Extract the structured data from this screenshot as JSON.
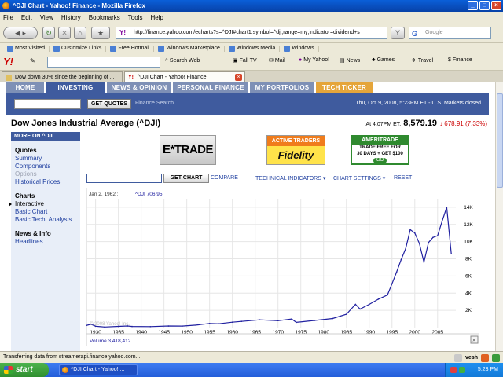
{
  "window": {
    "title": "^DJI Chart - Yahoo! Finance - Mozilla Firefox",
    "min": "_",
    "max": "□",
    "close": "×"
  },
  "menu": [
    "File",
    "Edit",
    "View",
    "History",
    "Bookmarks",
    "Tools",
    "Help"
  ],
  "nav": {
    "url": "http://finance.yahoo.com/echarts?s=^DJI#chart1:symbol=^dji;range=my;indicator=dividend+s",
    "search_placeholder": "Google",
    "back_icon": "back-arrow-icon",
    "reload_icon": "reload-icon"
  },
  "bookmarks": [
    "Most Visited",
    "Customize Links",
    "Free Hotmail",
    "Windows Marketplace",
    "Windows Media",
    "Windows"
  ],
  "ytoolbar": {
    "logo": "Y!",
    "search_web": "Search Web",
    "items": [
      "Fall TV",
      "Mail",
      "My Yahoo!",
      "News",
      "Games",
      "Travel",
      "Finance"
    ]
  },
  "tabs": [
    {
      "label": "Dow down 30% since the beginning of ...",
      "active": false
    },
    {
      "label": "^DJI Chart - Yahoo! Finance",
      "active": true
    }
  ],
  "site": {
    "nav_tabs": [
      "HOME",
      "INVESTING",
      "NEWS & OPINION",
      "PERSONAL FINANCE",
      "MY PORTFOLIOS",
      "TECH TICKER"
    ],
    "get_quotes": "GET QUOTES",
    "finance_search": "Finance Search",
    "market_status": "Thu, Oct 9, 2008, 5:23PM ET - U.S. Markets closed.",
    "title": "Dow Jones Industrial Average (^DJI)",
    "quote_time": "At 4:07PM ET:",
    "price": "8,579.19",
    "change": "↓ 678.91 (7.33%)"
  },
  "leftnav": {
    "header": "MORE ON ^DJI",
    "groups": [
      {
        "title": "Quotes",
        "links": [
          {
            "label": "Summary",
            "state": "link"
          },
          {
            "label": "Components",
            "state": "link"
          },
          {
            "label": "Options",
            "state": "dim"
          },
          {
            "label": "Historical Prices",
            "state": "link"
          }
        ]
      },
      {
        "title": "Charts",
        "links": [
          {
            "label": "Interactive",
            "state": "current"
          },
          {
            "label": "Basic Chart",
            "state": "link"
          },
          {
            "label": "Basic Tech. Analysis",
            "state": "link"
          }
        ]
      },
      {
        "title": "News & Info",
        "links": [
          {
            "label": "Headlines",
            "state": "link"
          }
        ]
      }
    ]
  },
  "ads": {
    "etrade": "E*TRADE",
    "fidelity_top": "ACTIVE TRADERS",
    "fidelity_brand": "Fidelity",
    "td_top": "AMERITRADE",
    "td_line1": "TRADE FREE FOR",
    "td_line2": "30 DAYS + GET $100",
    "td_go": "GO"
  },
  "chart_controls": {
    "get_chart": "GET CHART",
    "compare": "COMPARE",
    "indicators": "TECHNICAL INDICATORS ▾",
    "settings": "CHART SETTINGS ▾",
    "reset": "RESET"
  },
  "chart_data": {
    "type": "line",
    "legend_date": "Jan 2, 1962 :",
    "series_name": "^DJI 706.95",
    "copyright": "© 2008 Yahoo! Inc.",
    "volume_label": "Volume 3,418,412",
    "x_ticks": [
      "1930",
      "1935",
      "1940",
      "1945",
      "1950",
      "1955",
      "1960",
      "1965",
      "1970",
      "1975",
      "1980",
      "1985",
      "1990",
      "1995",
      "2000",
      "2005"
    ],
    "y_ticks": [
      "2K",
      "4K",
      "6K",
      "8K",
      "10K",
      "12K",
      "14K"
    ],
    "xlim": [
      1928,
      2009
    ],
    "ylim": [
      0,
      15000
    ],
    "colors": {
      "line": "#2020a0",
      "grid": "#e6e6e6"
    },
    "x": [
      1928,
      1929,
      1930,
      1932,
      1935,
      1937,
      1938,
      1942,
      1946,
      1949,
      1952,
      1955,
      1957,
      1960,
      1962,
      1966,
      1970,
      1973,
      1974,
      1978,
      1982,
      1985,
      1987,
      1988,
      1990,
      1992,
      1994,
      1995,
      1996,
      1997,
      1998,
      1999,
      2000,
      2001,
      2002,
      2003,
      2004,
      2005,
      2006,
      2007,
      2008
    ],
    "values": [
      250,
      380,
      160,
      60,
      140,
      185,
      130,
      110,
      180,
      175,
      280,
      480,
      440,
      620,
      710,
      900,
      800,
      1000,
      600,
      820,
      1050,
      1550,
      2700,
      2150,
      2700,
      3300,
      3800,
      5100,
      6450,
      7900,
      9200,
      11400,
      11000,
      9800,
      7600,
      9900,
      10500,
      10700,
      12400,
      14000,
      8579
    ]
  },
  "status": {
    "text": "Transferring data from streamerapi.finance.yahoo.com...",
    "right": "vesh"
  },
  "taskbar": {
    "start": "start",
    "item": "^DJI Chart - Yahoo! ...",
    "time": "5:23 PM"
  }
}
